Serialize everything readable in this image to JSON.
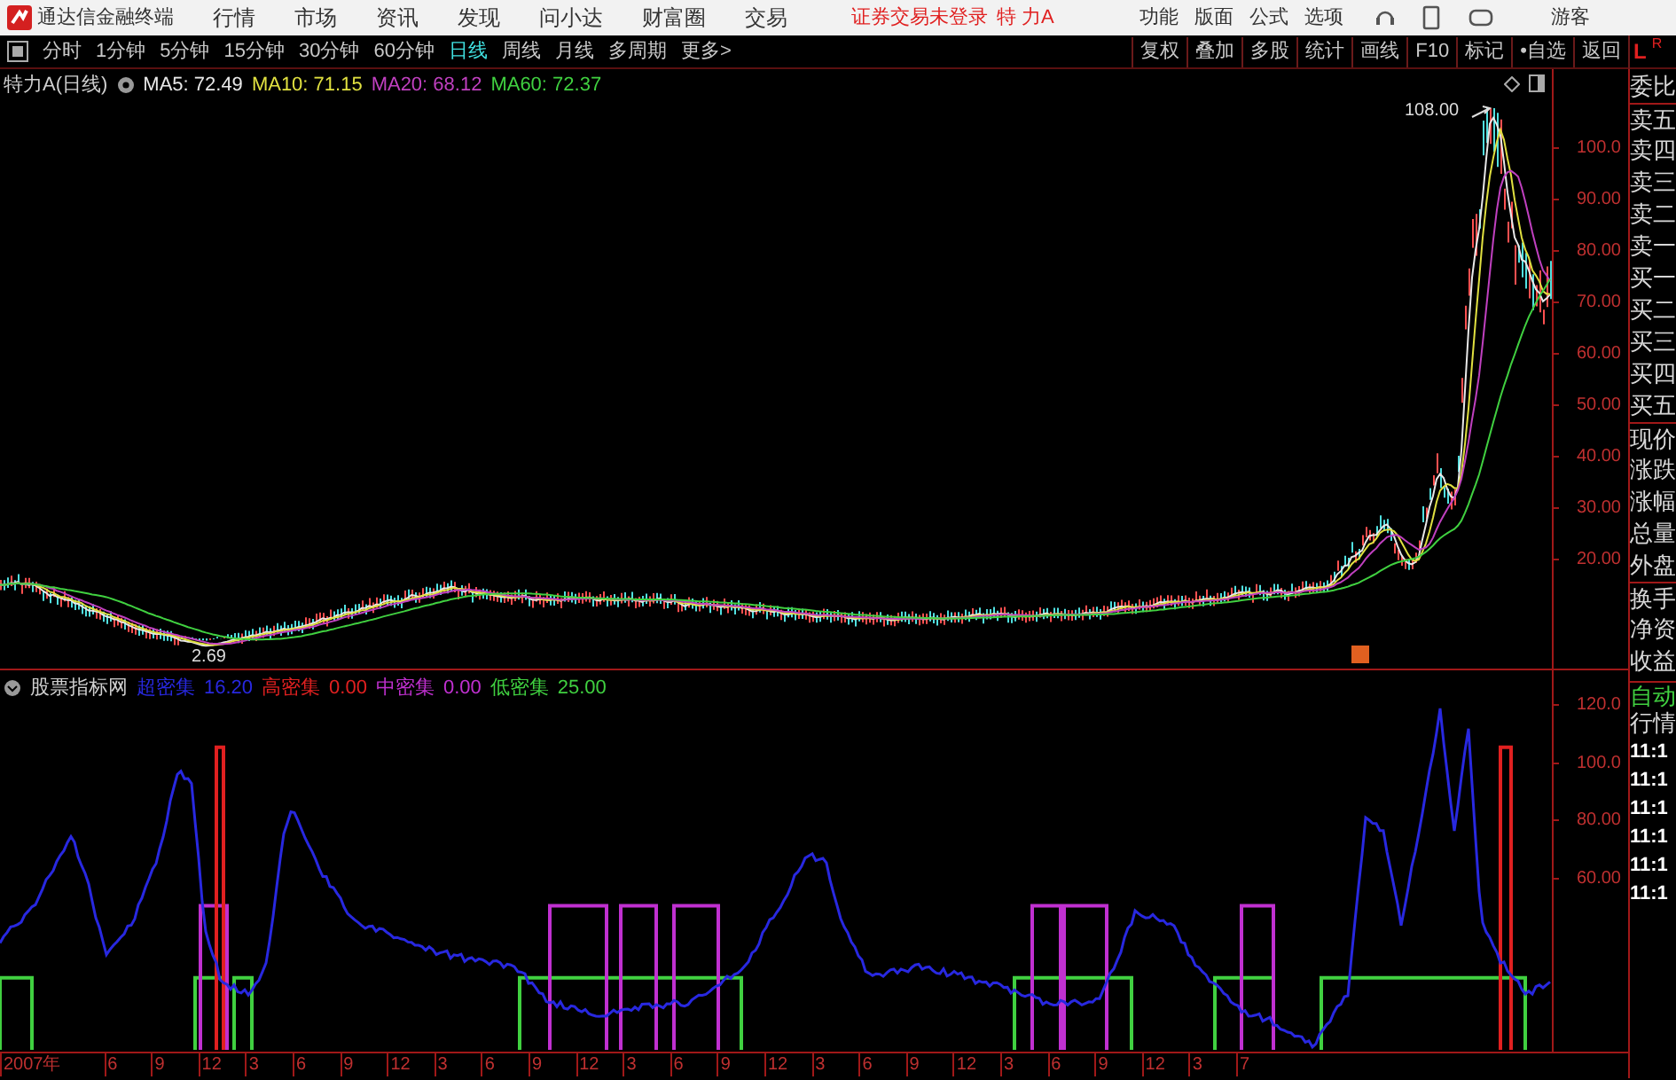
{
  "title_bar": {
    "app_name": "通达信金融终端",
    "menus": [
      "行情",
      "市场",
      "资讯",
      "发现",
      "问小达",
      "财富圈",
      "交易"
    ],
    "login_status": "证券交易未登录",
    "stock_name": "特 力A",
    "tools": [
      "功能",
      "版面",
      "公式",
      "选项"
    ],
    "user": "游客"
  },
  "period_tabs": [
    {
      "label": "分时",
      "selected": false
    },
    {
      "label": "1分钟",
      "selected": false
    },
    {
      "label": "5分钟",
      "selected": false
    },
    {
      "label": "15分钟",
      "selected": false
    },
    {
      "label": "30分钟",
      "selected": false
    },
    {
      "label": "60分钟",
      "selected": false
    },
    {
      "label": "日线",
      "selected": true
    },
    {
      "label": "周线",
      "selected": false
    },
    {
      "label": "月线",
      "selected": false
    },
    {
      "label": "多周期",
      "selected": false
    },
    {
      "label": "更多>",
      "selected": false
    }
  ],
  "chart_tools": [
    "复权",
    "叠加",
    "多股",
    "统计",
    "画线",
    "F10",
    "标记",
    "•自选",
    "返回"
  ],
  "main_chart": {
    "title": "特力A(日线)",
    "ma": [
      {
        "label": "MA5: 72.49",
        "color": "#e8e8e8"
      },
      {
        "label": "MA10: 71.15",
        "color": "#e0e040"
      },
      {
        "label": "MA20: 68.12",
        "color": "#c040c0"
      },
      {
        "label": "MA60: 72.37",
        "color": "#40d040"
      }
    ],
    "high_label": "108.00",
    "low_label": "2.69",
    "y_axis": [
      "100.0",
      "90.00",
      "80.00",
      "70.00",
      "60.00",
      "50.00",
      "40.00",
      "30.00",
      "20.00"
    ]
  },
  "indicator": {
    "title": "股票指标网",
    "legend": [
      {
        "name": "超密集",
        "value": "16.20",
        "color": "#2828e0"
      },
      {
        "name": "高密集",
        "value": "0.00",
        "color": "#e02020"
      },
      {
        "name": "中密集",
        "value": "0.00",
        "color": "#c030d0"
      },
      {
        "name": "低密集",
        "value": "25.00",
        "color": "#40d040"
      }
    ],
    "y_axis": [
      "120.0",
      "100.0",
      "80.00",
      "60.00"
    ]
  },
  "x_axis": [
    "2007年",
    "6",
    "9",
    "12",
    "3",
    "6",
    "9",
    "12",
    "3",
    "6",
    "9",
    "12",
    "3",
    "6",
    "9",
    "12",
    "3",
    "6",
    "9",
    "12",
    "3",
    "6",
    "9",
    "12",
    "3",
    "7"
  ],
  "quote_panel": {
    "badge": "L",
    "badge_small": "R",
    "labels": [
      "委比",
      "卖五",
      "卖四",
      "卖三",
      "卖二",
      "卖一",
      "买一",
      "买二",
      "买三",
      "买四",
      "买五",
      "现价",
      "涨跌",
      "涨幅",
      "总量",
      "外盘",
      "换手",
      "净资",
      "收益"
    ],
    "auto": "自动",
    "market": "行情",
    "times": [
      "11:1",
      "11:1",
      "11:1",
      "11:1",
      "11:1",
      "11:1"
    ]
  }
}
